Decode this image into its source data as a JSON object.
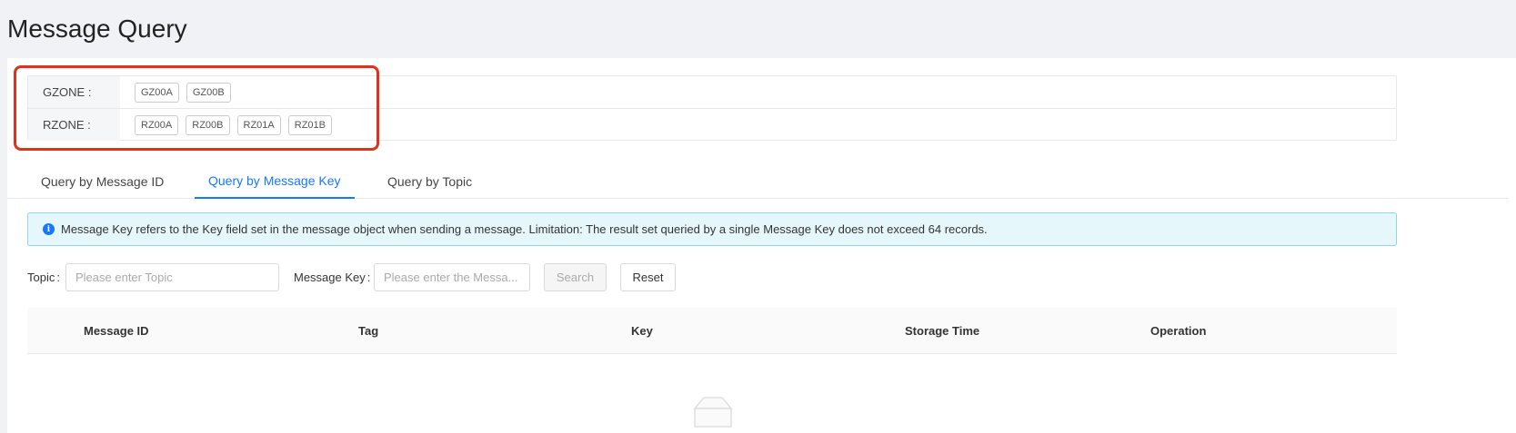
{
  "page_title": "Message Query",
  "zones": {
    "gzone": {
      "label": "GZONE :",
      "tags": [
        "GZ00A",
        "GZ00B"
      ]
    },
    "rzone": {
      "label": "RZONE :",
      "tags": [
        "RZ00A",
        "RZ00B",
        "RZ01A",
        "RZ01B"
      ]
    }
  },
  "tabs": [
    {
      "label": "Query by Message ID",
      "active": false
    },
    {
      "label": "Query by Message Key",
      "active": true
    },
    {
      "label": "Query by Topic",
      "active": false
    }
  ],
  "alert": {
    "text": "Message Key refers to the Key field set in the message object when sending a message. Limitation: The result set queried by a single Message Key does not exceed 64 records."
  },
  "form": {
    "topic_label": "Topic",
    "topic_placeholder": "Please enter Topic",
    "key_label": "Message Key",
    "key_placeholder": "Please enter the Messa...",
    "search_label": "Search",
    "reset_label": "Reset"
  },
  "table": {
    "columns": [
      "Message ID",
      "Tag",
      "Key",
      "Storage Time",
      "Operation"
    ]
  },
  "colors": {
    "accent": "#1677ff",
    "highlight": "#e0301e",
    "alert_bg": "#e6f7fb"
  }
}
